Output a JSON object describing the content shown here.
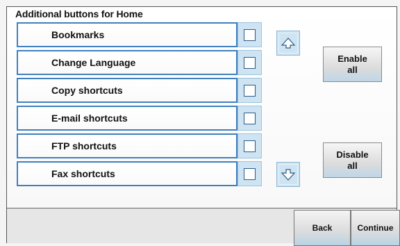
{
  "screen": {
    "title": "Additional buttons for Home"
  },
  "items": [
    {
      "label": "Bookmarks",
      "checked": false
    },
    {
      "label": "Change Language",
      "checked": false
    },
    {
      "label": "Copy shortcuts",
      "checked": false
    },
    {
      "label": "E-mail shortcuts",
      "checked": false
    },
    {
      "label": "FTP shortcuts",
      "checked": false
    },
    {
      "label": "Fax shortcuts",
      "checked": false
    }
  ],
  "controls": {
    "scroll_up_icon": "triangle-up-outline",
    "scroll_down_icon": "arrow-down-outline",
    "enable_all_label": "Enable\nall",
    "disable_all_label": "Disable\nall"
  },
  "footer": {
    "back_label": "Back",
    "continue_label": "Continue"
  },
  "colors": {
    "accent_border": "#3f7fbf",
    "checkbox_bg": "#cfe4f2"
  }
}
